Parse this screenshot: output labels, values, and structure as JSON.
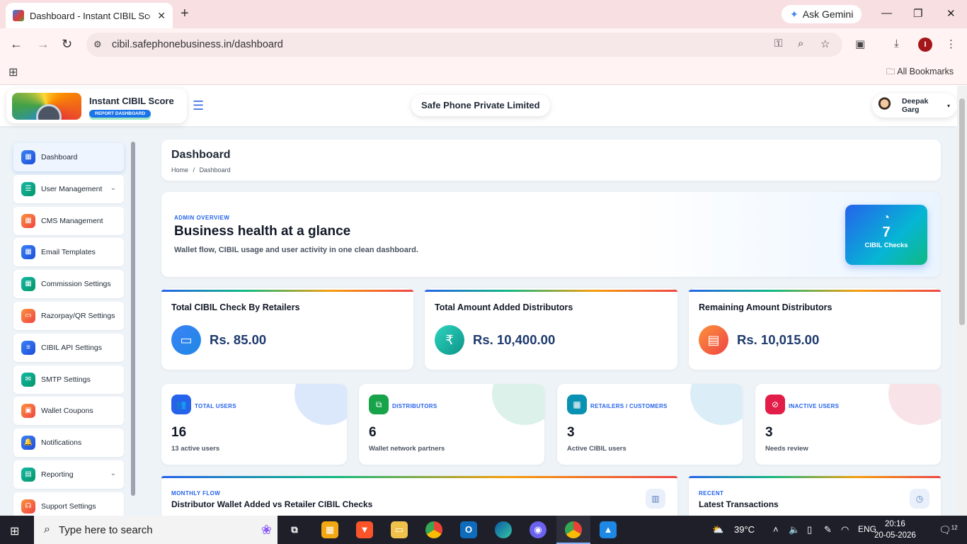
{
  "browser": {
    "tab_title": "Dashboard - Instant CIBIL Score",
    "new_tab": "+",
    "ask_gemini": "Ask Gemini",
    "url": "cibil.safephonebusiness.in/dashboard",
    "profile_initial": "I",
    "all_bookmarks": "All Bookmarks"
  },
  "header": {
    "brand_name": "Instant CIBIL Score",
    "brand_tag": "REPORT DASHBOARD",
    "company": "Safe Phone Private Limited",
    "user_name": "Deepak Garg"
  },
  "sidebar": {
    "items": [
      {
        "label": "Dashboard",
        "icon": "grid-icon",
        "color": "blue",
        "active": true
      },
      {
        "label": "User Management",
        "icon": "users-icon",
        "color": "teal",
        "chevron": true
      },
      {
        "label": "CMS Management",
        "icon": "grid-icon",
        "color": "orange"
      },
      {
        "label": "Email Templates",
        "icon": "grid-icon",
        "color": "blue"
      },
      {
        "label": "Commission Settings",
        "icon": "grid-icon",
        "color": "teal"
      },
      {
        "label": "Razorpay/QR Settings",
        "icon": "card-icon",
        "color": "orange"
      },
      {
        "label": "CIBIL API Settings",
        "icon": "sliders-icon",
        "color": "blue"
      },
      {
        "label": "SMTP Settings",
        "icon": "mail-icon",
        "color": "teal"
      },
      {
        "label": "Wallet Coupons",
        "icon": "ticket-icon",
        "color": "orange"
      },
      {
        "label": "Notifications",
        "icon": "bell-icon",
        "color": "blue"
      },
      {
        "label": "Reporting",
        "icon": "report-icon",
        "color": "teal",
        "chevron": true
      },
      {
        "label": "Support Settings",
        "icon": "headset-icon",
        "color": "orange"
      }
    ]
  },
  "page": {
    "title": "Dashboard",
    "breadcrumb_home": "Home",
    "breadcrumb_sep": "/",
    "breadcrumb_current": "Dashboard"
  },
  "hero": {
    "kicker": "ADMIN OVERVIEW",
    "title": "Business health at a glance",
    "subtitle": "Wallet flow, CIBIL usage and user activity in one clean dashboard.",
    "badge_value": "7",
    "badge_label": "CIBIL Checks"
  },
  "stats": [
    {
      "title": "Total CIBIL Check By Retailers",
      "value": "Rs. 85.00",
      "icon": "wallet-icon",
      "color": "#1e88e5"
    },
    {
      "title": "Total Amount Added Distributors",
      "value": "Rs. 10,400.00",
      "icon": "rupee-icon",
      "color": "#14b8a6"
    },
    {
      "title": "Remaining Amount Distributors",
      "value": "Rs. 10,015.00",
      "icon": "briefcase-icon",
      "color": "#f97316"
    }
  ],
  "mini_stats": [
    {
      "label": "TOTAL USERS",
      "value": "16",
      "desc": "13 active users",
      "icon": "users-icon",
      "color": "#2563eb",
      "blob": "#dbe8fb"
    },
    {
      "label": "DISTRIBUTORS",
      "value": "6",
      "desc": "Wallet network partners",
      "icon": "network-icon",
      "color": "#16a34a",
      "blob": "#dcf1ea"
    },
    {
      "label": "RETAILERS / CUSTOMERS",
      "value": "3",
      "desc": "Active CIBIL users",
      "icon": "store-icon",
      "color": "#0891b2",
      "blob": "#dbeef7"
    },
    {
      "label": "INACTIVE USERS",
      "value": "3",
      "desc": "Needs review",
      "icon": "user-off-icon",
      "color": "#e11d48",
      "blob": "#f7e3e8"
    }
  ],
  "panels": {
    "flow_kicker": "MONTHLY FLOW",
    "flow_title": "Distributor Wallet Added vs Retailer CIBIL Checks",
    "recent_kicker": "RECENT",
    "recent_title": "Latest Transactions"
  },
  "taskbar": {
    "search_placeholder": "Type here to search",
    "weather": "39°C",
    "language": "ENG",
    "time": "20:16",
    "date": "20-05-2026",
    "notifications": "12"
  }
}
